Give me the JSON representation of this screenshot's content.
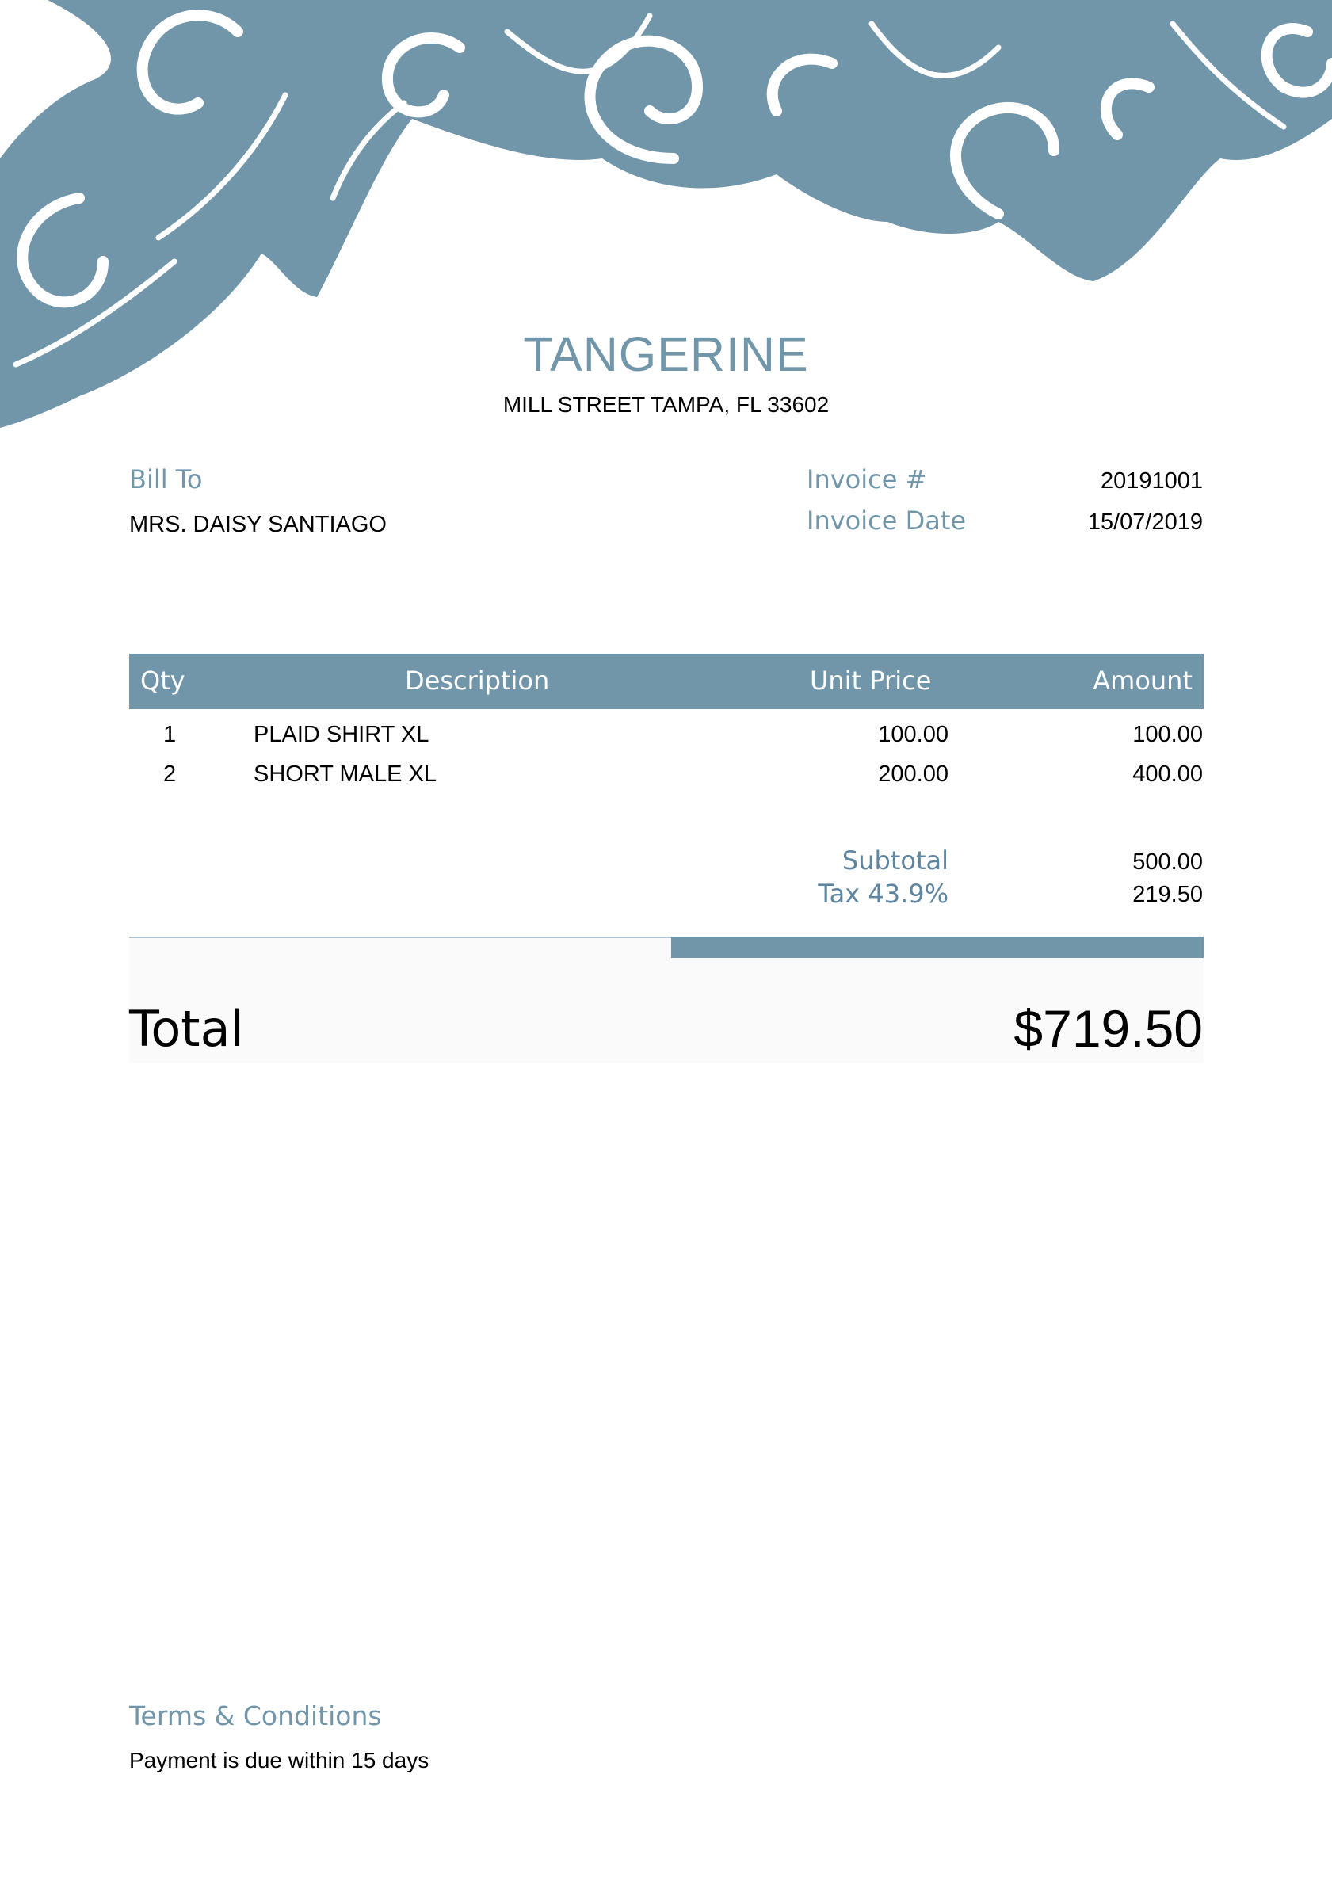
{
  "company": {
    "name": "TANGERINE",
    "address": "MILL STREET TAMPA, FL 33602"
  },
  "bill_to": {
    "label": "Bill To",
    "name": "MRS. DAISY SANTIAGO"
  },
  "invoice": {
    "number_label": "Invoice #",
    "number": "20191001",
    "date_label": "Invoice Date",
    "date": "15/07/2019"
  },
  "table": {
    "headers": [
      "Qty",
      "Description",
      "Unit Price",
      "Amount"
    ],
    "rows": [
      {
        "qty": "1",
        "description": "PLAID SHIRT XL",
        "unit_price": "100.00",
        "amount": "100.00"
      },
      {
        "qty": "2",
        "description": "SHORT MALE XL",
        "unit_price": "200.00",
        "amount": "400.00"
      }
    ]
  },
  "summary": {
    "subtotal_label": "Subtotal",
    "subtotal": "500.00",
    "tax_label": "Tax 43.9%",
    "tax": "219.50"
  },
  "total": {
    "label": "Total",
    "value": "$719.50"
  },
  "terms": {
    "label": "Terms & Conditions",
    "text": "Payment is due within 15 days"
  },
  "colors": {
    "accent": "#7196aa",
    "summary_text": "#5f86a0"
  },
  "decoration": "floral-ornament"
}
